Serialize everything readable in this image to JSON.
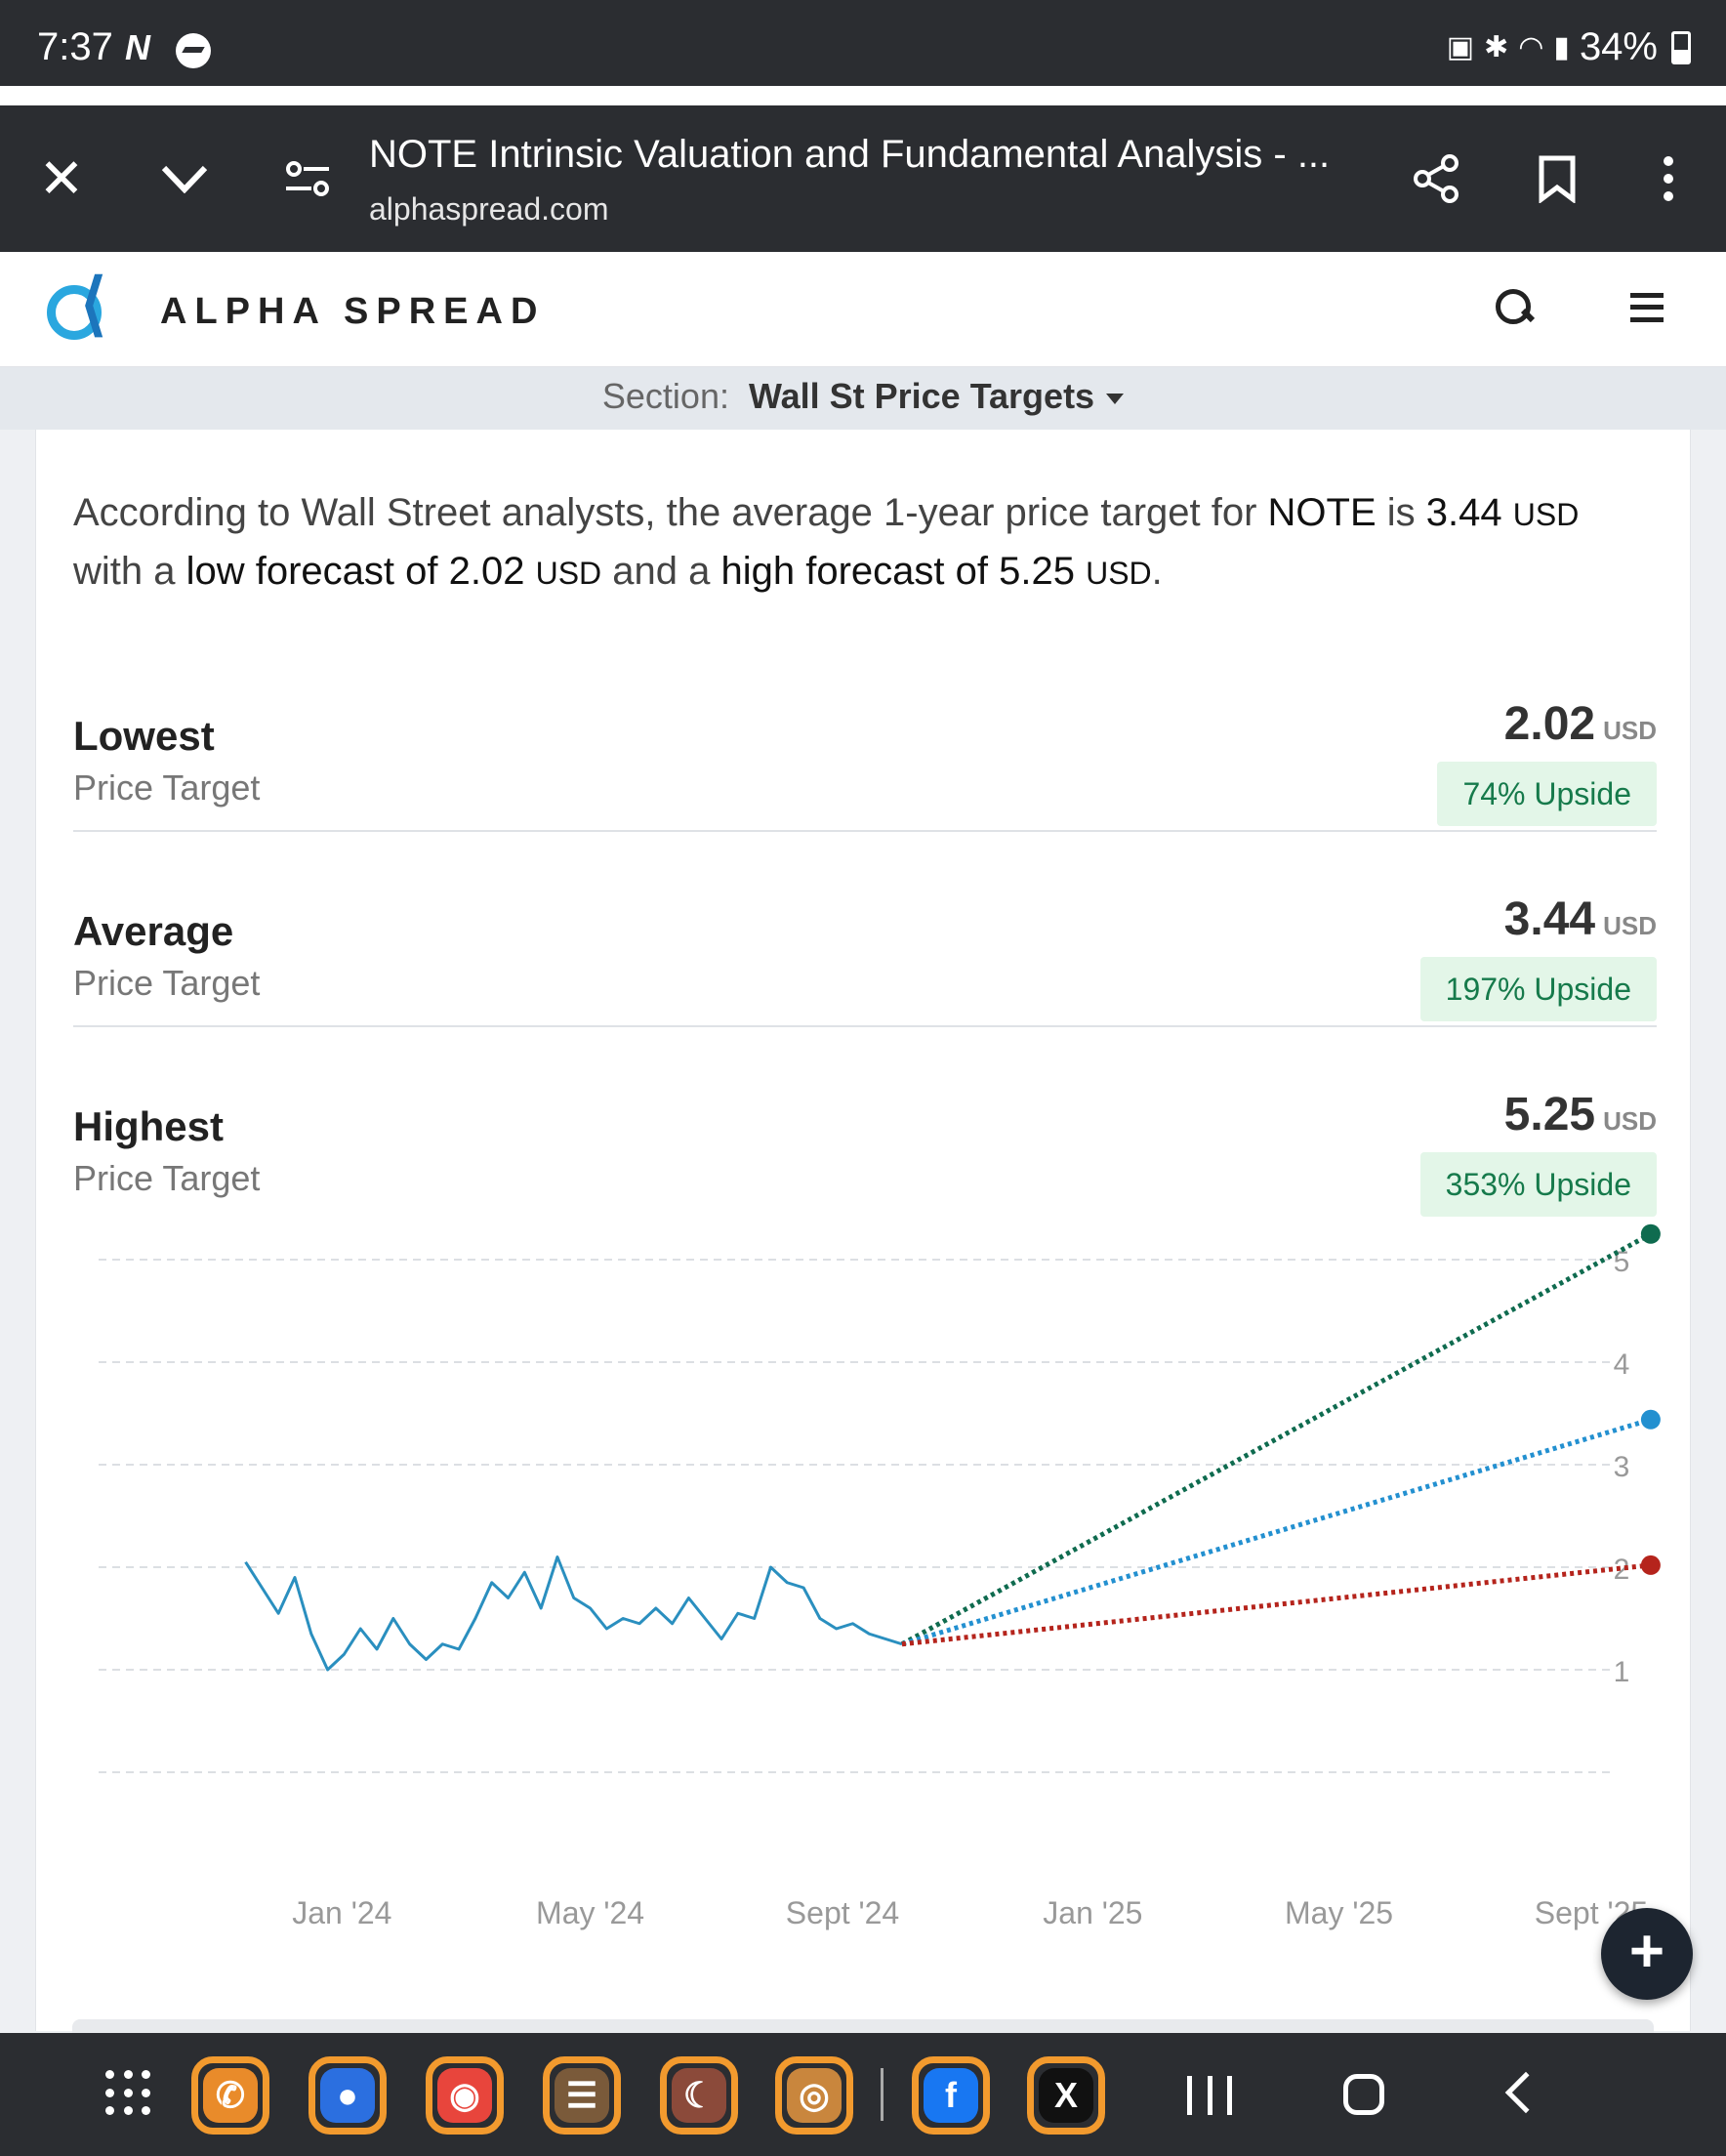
{
  "status_bar": {
    "time": "7:37",
    "battery": "34%"
  },
  "browser": {
    "title": "NOTE Intrinsic Valuation and Fundamental Analysis - ...",
    "url": "alphaspread.com"
  },
  "site": {
    "logo_text": "ALPHA SPREAD"
  },
  "section": {
    "label": "Section:",
    "value": "Wall St Price Targets"
  },
  "summary": {
    "p1": "According to Wall Street analysts, the average 1-year price target for ",
    "ticker": "NOTE",
    "p2": " is ",
    "avg": "3.44",
    "unit": "USD",
    "p3": " with a ",
    "low_label": "low forecast of 2.02",
    "p4": " and a ",
    "high_label": "high forecast of 5.25",
    "p5": "."
  },
  "targets": [
    {
      "name": "Lowest",
      "sub": "Price Target",
      "value": "2.02",
      "unit": "USD",
      "badge": "74% Upside"
    },
    {
      "name": "Average",
      "sub": "Price Target",
      "value": "3.44",
      "unit": "USD",
      "badge": "197% Upside"
    },
    {
      "name": "Highest",
      "sub": "Price Target",
      "value": "5.25",
      "unit": "USD",
      "badge": "353% Upside"
    }
  ],
  "chart_data": {
    "type": "line",
    "x_ticks": [
      "Jan '24",
      "May '24",
      "Sept '24",
      "Jan '25",
      "May '25",
      "Sept '25"
    ],
    "y_ticks": [
      "1",
      "2",
      "3",
      "4",
      "5"
    ],
    "ylim": [
      0,
      6
    ],
    "grid": true,
    "history": [
      2.05,
      1.8,
      1.55,
      1.9,
      1.35,
      1.0,
      1.15,
      1.4,
      1.2,
      1.5,
      1.25,
      1.1,
      1.25,
      1.2,
      1.5,
      1.85,
      1.7,
      1.95,
      1.6,
      2.1,
      1.7,
      1.6,
      1.4,
      1.5,
      1.45,
      1.6,
      1.45,
      1.7,
      1.5,
      1.3,
      1.55,
      1.5,
      2.0,
      1.85,
      1.8,
      1.5,
      1.4,
      1.45,
      1.35,
      1.3,
      1.25
    ],
    "history_start": "2023-11-15",
    "history_end": "2024-09-30",
    "targets": [
      {
        "name": "Highest",
        "value": 5.25,
        "color": "#0f6b4f"
      },
      {
        "name": "Average",
        "value": 3.44,
        "color": "#2390d0"
      },
      {
        "name": "Lowest",
        "value": 2.02,
        "color": "#b5241c"
      }
    ],
    "target_date": "2025-09-30",
    "line_color": "#2a8fbf"
  }
}
